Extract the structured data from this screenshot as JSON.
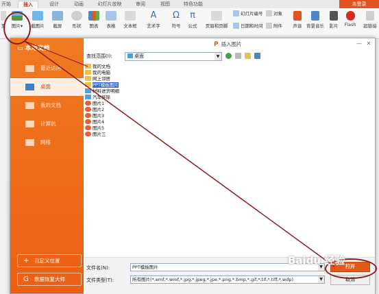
{
  "ribbon_tabs": [
    "开始",
    "插入",
    "设计",
    "动画",
    "幻灯片放映",
    "审阅",
    "视图",
    "特色功能"
  ],
  "login_label": "未登录",
  "ribbon_buttons": [
    {
      "label": "页",
      "icon": "page-icon"
    },
    {
      "label": "图片",
      "icon": "picture-icon"
    },
    {
      "label": "截图片",
      "icon": "screenshot-icon"
    },
    {
      "label": "截屏",
      "icon": "capture-icon"
    },
    {
      "label": "形状",
      "icon": "shape-icon"
    },
    {
      "label": "图表",
      "icon": "chart-icon"
    },
    {
      "label": "表格",
      "icon": "table-icon"
    },
    {
      "label": "文本框",
      "icon": "textbox-icon"
    },
    {
      "label": "艺术字",
      "icon": "wordart-icon"
    },
    {
      "label": "符号",
      "icon": "symbol-icon"
    },
    {
      "label": "公式",
      "icon": "formula-icon"
    },
    {
      "label": "页眉和页脚",
      "icon": "header-footer-icon"
    },
    {
      "label": "声音",
      "icon": "sound-icon"
    },
    {
      "label": "背景音乐",
      "icon": "music-icon"
    },
    {
      "label": "影片",
      "icon": "movie-icon"
    },
    {
      "label": "Flash",
      "icon": "flash-icon"
    },
    {
      "label": "超链接",
      "icon": "hyperlink-icon"
    }
  ],
  "ribbon_small": [
    "幻灯片编号",
    "对象",
    "日期和时间",
    "附件"
  ],
  "dialog": {
    "title": "插入图片",
    "sidebar_title": "本地文档",
    "sidebar_items": [
      "最近访问",
      "桌面",
      "我的文档",
      "计算机",
      "网络"
    ],
    "selected_sidebar": "桌面",
    "sidebar_buttons": [
      "自定义位置",
      "数据恢复大师"
    ],
    "lookin_label": "查找范围(I):",
    "lookin_value": "桌面",
    "files": [
      {
        "name": "我的文档",
        "icon": "folder"
      },
      {
        "name": "我的电脑",
        "icon": "folder"
      },
      {
        "name": "网上邻居",
        "icon": "folder"
      },
      {
        "name": "PPT模板图片",
        "icon": "folder",
        "selected": true
      },
      {
        "name": "材料进货明细",
        "icon": "folder2"
      },
      {
        "name": "汽车排除",
        "icon": "folder2"
      },
      {
        "name": "图片1",
        "icon": "pic"
      },
      {
        "name": "图片2",
        "icon": "pic"
      },
      {
        "name": "图片3",
        "icon": "pic"
      },
      {
        "name": "图片4",
        "icon": "pic"
      },
      {
        "name": "图片5",
        "icon": "pic"
      },
      {
        "name": "图片三",
        "icon": "pic"
      }
    ],
    "filename_label": "文件名(N):",
    "filename_value": "PPT模板图片",
    "filetype_label": "文件类型(T):",
    "filetype_value": "所有图片(*.emf,*.wmf,*.jpg,*.jpeg,*.jpe,*.png,*.bmp,*.gif,*.tif,*.tiff,*.wdp)",
    "open_label": "打开",
    "cancel_label": "取消"
  },
  "watermark": "Baidu 经验",
  "colors": {
    "accent": "#e2541f",
    "sidebar": "#ec5f13",
    "annotation": "#8b1c1c",
    "selection": "#3366cc"
  }
}
